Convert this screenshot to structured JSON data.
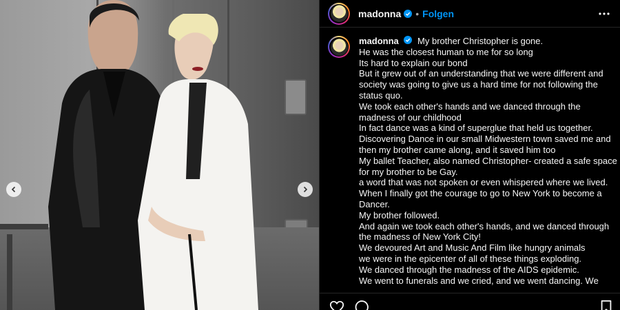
{
  "post": {
    "username": "madonna",
    "follow_label": "Folgen",
    "separator": "•"
  },
  "caption": {
    "username": "madonna",
    "lines": [
      "My brother Christopher is gone.",
      "He was the closest human to me for so long",
      "Its hard to explain our bond",
      "But it grew out of an understanding that we were different and",
      "society was going to give us a hard time for not following the",
      "status quo.",
      "We took each other's hands and we danced through the",
      "madness of our childhood",
      "In fact dance was a kind of superglue that held us together.",
      "Discovering Dance in our small Midwestern town saved me and",
      "then my brother came along, and it saved him too",
      "My ballet Teacher, also named Christopher- created a safe space",
      "for my brother to be Gay.",
      "a word that was not spoken or even whispered where we lived.",
      "When I finally got the courage to go to New York to become a",
      "Dancer.",
      "My brother followed.",
      "And again we took each other's hands, and we danced through",
      "the madness of New York City!",
      "We devoured Art and Music And Film like hungry animals",
      "we were in the epicenter of all of these things exploding.",
      "We danced through the madness of the AIDS epidemic.",
      "We went to funerals and we cried, and we went dancing. We"
    ]
  },
  "icons": {
    "verified": "verified-badge-icon",
    "more": "more-options-icon",
    "prev": "chevron-left-icon",
    "next": "chevron-right-icon",
    "like": "heart-icon",
    "comment": "comment-icon",
    "save": "bookmark-icon"
  },
  "colors": {
    "background": "#000000",
    "text": "#f5f5f5",
    "follow": "#0095f6",
    "verified": "#0095f6",
    "divider": "#262626"
  }
}
